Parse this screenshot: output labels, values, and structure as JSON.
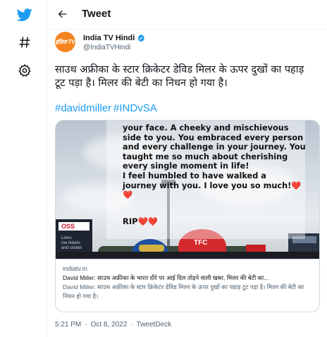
{
  "header": {
    "title": "Tweet"
  },
  "author": {
    "name": "India TV Hindi",
    "handle": "@IndiaTVHindi",
    "avatar_text": "इंडिया TV"
  },
  "tweet": {
    "text": "साउथ अफ्रीका के स्टार क्रिकेटर डेविड मिलर के ऊपर दुखों का पहाड़ टूट पड़ा है। मिलर की बेटी का निधन हो गया है।",
    "hashtags": [
      "#davidmiller",
      "#INDvSA"
    ]
  },
  "card": {
    "image_caption_lines": [
      "your face. A cheeky and mischievous",
      "side to you. You embraced every person",
      "and every challenge in your journey. You",
      "taught me so much about cherishing",
      "every single moment in life!",
      "I feel humbled to have walked a",
      "journey with you. I love you so much!"
    ],
    "image_hearts": "❤️",
    "image_heart_line": "❤️",
    "rip_text": "RIP",
    "rip_hearts": "❤️❤️",
    "stand_sign": "OSS",
    "stand_sub": "Lions\nme tickets\nand cricket",
    "cap_text": "TFC",
    "stadium_sign": "",
    "domain": "indiatv.in",
    "title": "David Miller: साउथ अफ्रीका के भारत दौरे पर आई दिल तोड़ने वाली खबर, मिलर की बेटी का...",
    "description": "David Miller: साउथ अफ्रीका के स्टार क्रिकेटर डेविड मिलर के ऊपर दुखों का पहाड़ टूट पड़ा है। मिलर की बेटी का निधन हो गया है।"
  },
  "footer": {
    "time": "5:21 PM",
    "date": "Oct 8, 2022",
    "source": "TweetDeck",
    "separator": "·"
  },
  "colors": {
    "accent": "#1d9bf0",
    "text": "#0f1419",
    "muted": "#536471",
    "border": "#cfd9de",
    "avatar_bg": "#f5841f"
  },
  "icons": {
    "logo": "twitter-bird-icon",
    "explore": "hashtag-icon",
    "settings": "gear-icon",
    "back": "arrow-left-icon",
    "verified": "verified-badge-icon"
  }
}
